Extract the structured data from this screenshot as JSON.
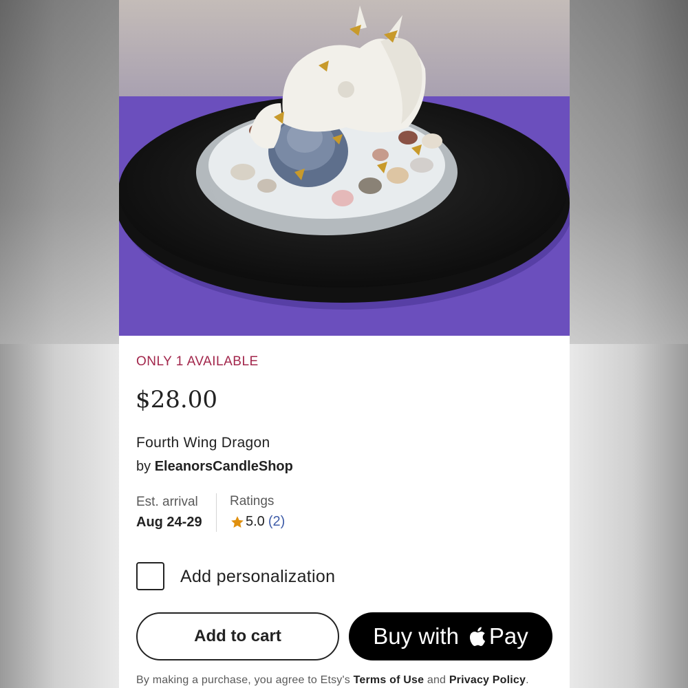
{
  "listing": {
    "availability": "ONLY 1 AVAILABLE",
    "price": "$28.00",
    "title": "Fourth Wing Dragon",
    "by_prefix": "by ",
    "shop_name": "EleanorsCandleShop"
  },
  "details": {
    "est_arrival_label": "Est. arrival",
    "est_arrival_value": "Aug 24-29",
    "ratings_label": "Ratings",
    "rating_value": "5.0",
    "rating_count": "(2)"
  },
  "personalization": {
    "label": "Add personalization",
    "checked": false
  },
  "buttons": {
    "add_to_cart": "Add to cart",
    "buy_with": "Buy with",
    "pay": "Pay"
  },
  "legal": {
    "prefix": "By making a purchase, you agree to Etsy's ",
    "terms": "Terms of Use",
    "and": " and ",
    "privacy": "Privacy Policy",
    "suffix": "."
  },
  "icons": {
    "star": "star-icon",
    "apple": "apple-logo-icon",
    "checkbox": "checkbox-icon"
  },
  "colors": {
    "availability": "#a2264b",
    "rating_count": "#3f5da8",
    "star": "#e0900f",
    "pay_button": "#000000"
  }
}
